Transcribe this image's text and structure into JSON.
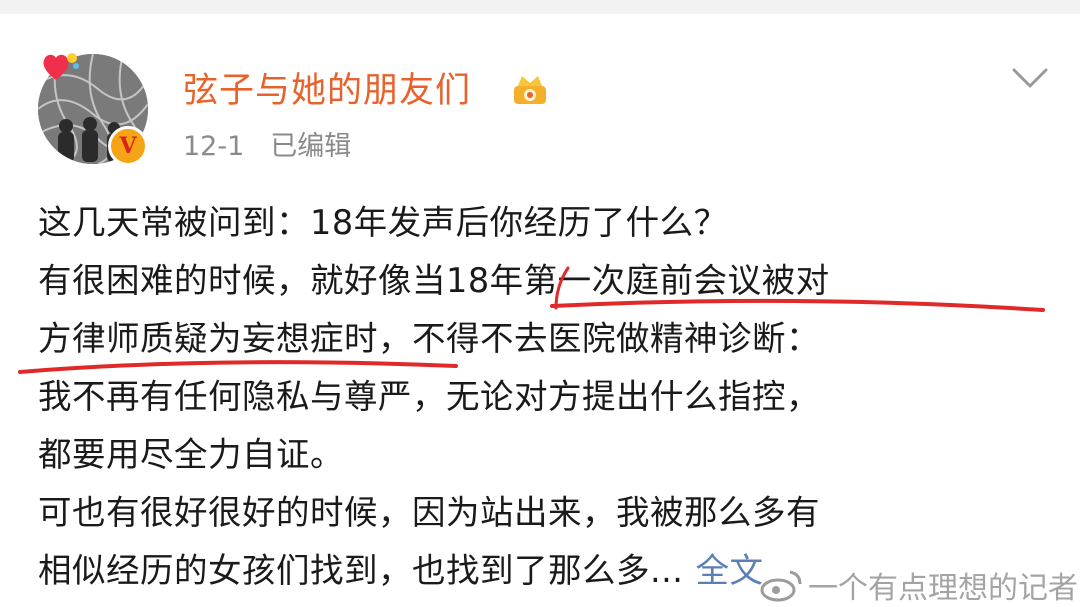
{
  "post": {
    "username": "弦子与她的朋友们",
    "date": "12-1",
    "edited": "已编辑",
    "verified_badge": "V",
    "lines": [
      "这几天常被问到：18年发声后你经历了什么？",
      "有很困难的时候，就好像当18年第一次庭前会议被对",
      "方律师质疑为妄想症时，不得不去医院做精神诊断：",
      "我不再有任何隐私与尊严，无论对方提出什么指控，",
      "都要用尽全力自证。",
      "可也有很好很好的时候，因为站出来，我被那么多有",
      "相似经历的女孩们找到，也找到了那么多..."
    ],
    "full_text_link": "全文",
    "watermark": "一个有点理想的记者"
  },
  "icons": {
    "avatar": "avatar-image",
    "heart": "heart-badge-icon",
    "crown": "crown-icon",
    "chevron": "chevron-down-icon",
    "weibo": "weibo-logo-icon"
  },
  "colors": {
    "username": "#e8622c",
    "meta": "#8a8a8a",
    "link": "#5b7fb4",
    "underline": "#e02a2a"
  }
}
